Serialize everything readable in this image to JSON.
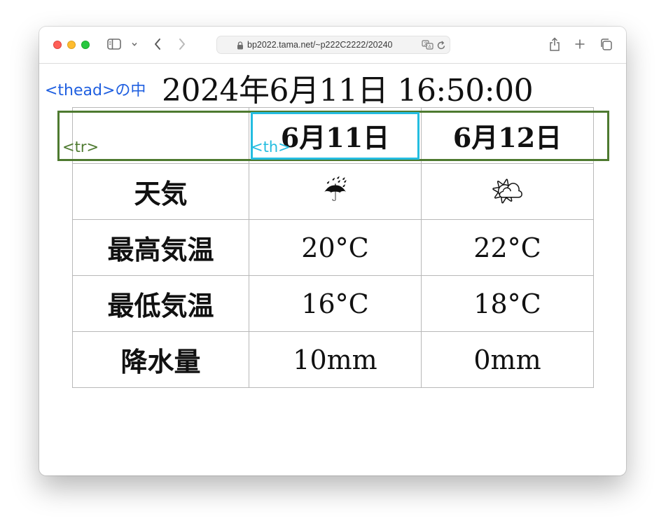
{
  "browser": {
    "url": "bp2022.tama.net/~p222C2222/20240",
    "colors": {
      "close": "#fe5f57",
      "minimize": "#febc2e",
      "zoom": "#28c840"
    },
    "icons": [
      "sidebar-icon",
      "chevron-down-icon",
      "back-icon",
      "forward-icon",
      "lock-icon",
      "translate-icon",
      "reload-icon",
      "share-icon",
      "new-tab-icon",
      "tabs-overview-icon"
    ]
  },
  "page": {
    "datetime": "2024年6月11日 16:50:00",
    "annotations": {
      "thead": "<thead>の中",
      "tr": "<tr>",
      "th": "<th>"
    },
    "annotation_colors": {
      "thead": "#1f5fe0",
      "tr": "#4e7a30",
      "th": "#24bde0"
    }
  },
  "table": {
    "header": [
      "",
      "6月11日",
      "6月12日"
    ],
    "rows": [
      {
        "label": "天気",
        "day1": "☔",
        "day2": "🌤"
      },
      {
        "label": "最高気温",
        "day1": "20°C",
        "day2": "22°C"
      },
      {
        "label": "最低気温",
        "day1": "16°C",
        "day2": "18°C"
      },
      {
        "label": "降水量",
        "day1": "10mm",
        "day2": "0mm"
      }
    ]
  }
}
